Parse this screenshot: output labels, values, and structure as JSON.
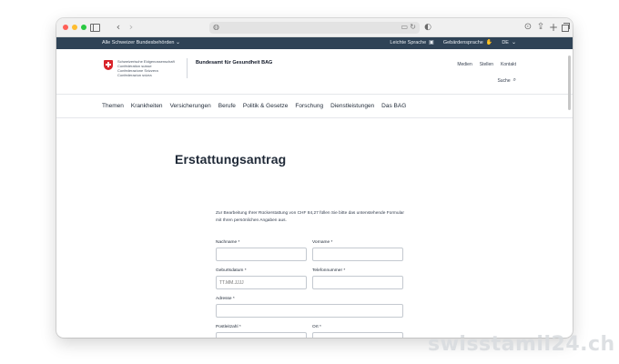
{
  "browser": {
    "address_left_icon": "privacy-report-icon",
    "address_right_icons": "reader-reload-icons"
  },
  "topbar": {
    "all_authorities": "Alle Schweizer Bundesbehörden",
    "easy_language": "Leichte Sprache",
    "sign_language": "Gebärdensprache",
    "language": "DE"
  },
  "header": {
    "confed_lines": [
      "Schweizerische Eidgenossenschaft",
      "Confédération suisse",
      "Confederazione Svizzera",
      "Confederaziun svizra"
    ],
    "office_name": "Bundesamt für Gesundheit BAG",
    "links": [
      "Medien",
      "Stellen",
      "Kontakt"
    ],
    "search_label": "Suche"
  },
  "nav": {
    "items": [
      "Themen",
      "Krankheiten",
      "Versicherungen",
      "Berufe",
      "Politik & Gesetze",
      "Forschung",
      "Dienstleistungen",
      "Das BAG"
    ]
  },
  "main": {
    "title": "Erstattungsantrag",
    "intro": "Zur Bearbeitung Ihrer Rückerstattung von CHF 84,27 füllen Sie bitte das unten­stehende Formular mit Ihren persönlichen Angaben aus."
  },
  "form": {
    "nachname_label": "Nachname *",
    "vorname_label": "Vorname *",
    "geburtsdatum_label": "Geburtsdatum *",
    "geburtsdatum_placeholder": "TT.MM.JJJJ",
    "telefon_label": "Telefonnummer *",
    "adresse_label": "Adresse *",
    "postleitzahl_label": "Postleitzahl *",
    "ort_label": "Ort *"
  },
  "watermark": "swisstamil24.ch",
  "colors": {
    "topbar_bg": "#2f4356",
    "swiss_red": "#d8232a"
  }
}
